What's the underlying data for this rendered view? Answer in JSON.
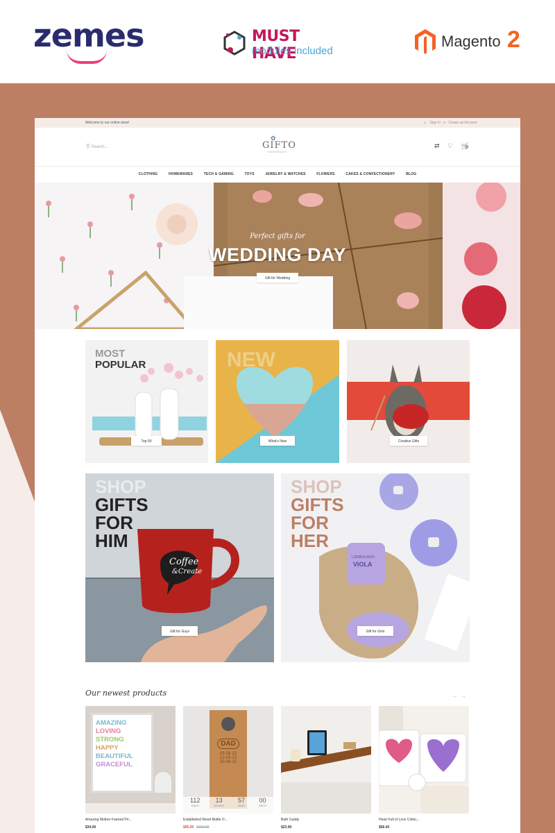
{
  "promo": {
    "zemes_logo": "zemes",
    "must_have_title": "MUST HAVE",
    "must_have_sub": "modules included",
    "magento_name": "Magento",
    "magento_version": "2"
  },
  "colors": {
    "accent": "#bc7f63",
    "zemes_navy": "#2a2c6e",
    "zemes_pink": "#ef3c7a",
    "must_have_pink": "#c2185b",
    "magento_orange": "#f26322"
  },
  "topbar": {
    "welcome": "Welcome to our online store!",
    "sign_in": "Sign In",
    "separator": "or",
    "create_account": "Create an Account"
  },
  "header": {
    "search_placeholder": "Search...",
    "brand_name": "GIFTO",
    "brand_sub": "HANDMADE",
    "cart_count": "0"
  },
  "nav": [
    "CLOTHING",
    "HOMEWARES",
    "TECH & GAMING",
    "TOYS",
    "JEWELRY & WATCHES",
    "FLOWERS",
    "CAKES & CONFECTIONERY",
    "BLOG"
  ],
  "hero": {
    "tagline": "Perfect gifts for",
    "title": "WEDDING DAY",
    "button": "Gift for Wedding"
  },
  "tiles": {
    "popular_line1": "MOST",
    "popular_line2": "POPULAR",
    "popular_button": "Top 50",
    "new_title": "NEW",
    "new_button": "What's New",
    "creative_button": "Creative Gifts",
    "him_shop": "SHOP",
    "him_line1": "GIFTS",
    "him_line2": "FOR",
    "him_line3": "HIM",
    "him_button": "Gift for Guys",
    "her_shop": "SHOP",
    "her_line1": "GIFTS",
    "her_line2": "FOR",
    "her_line3": "HER",
    "her_button": "Gift for Girls",
    "mug_text1": "Coffee",
    "mug_text2": "&Create",
    "jar_brand": "L'ERBOLARIO",
    "jar_name": "VIOLA"
  },
  "newest": {
    "title": "Our newest products",
    "products": [
      {
        "name": "Amazing Mother Framed Pri...",
        "price": "$34.00",
        "old_price": ""
      },
      {
        "name": "Established Wood Bottle O...",
        "price": "$95.00",
        "old_price": "$150.00"
      },
      {
        "name": "Bath Caddy",
        "price": "$23.00",
        "old_price": ""
      },
      {
        "name": "Heart Full of Love Collec...",
        "price": "$56.00",
        "old_price": ""
      }
    ],
    "poster_words": [
      "AMAZING",
      "LOVING",
      "STRONG",
      "HAPPY",
      "BEAUTIFUL",
      "GRACEFUL"
    ],
    "dad_label": "DAD",
    "dad_dates": [
      "05-26-10",
      "12-03-13",
      "03-09-15"
    ],
    "countdown": [
      "112",
      "13",
      "57",
      "00"
    ],
    "countdown_labels": [
      "DAYS",
      "HOURS",
      "MINS",
      "SECS"
    ]
  }
}
